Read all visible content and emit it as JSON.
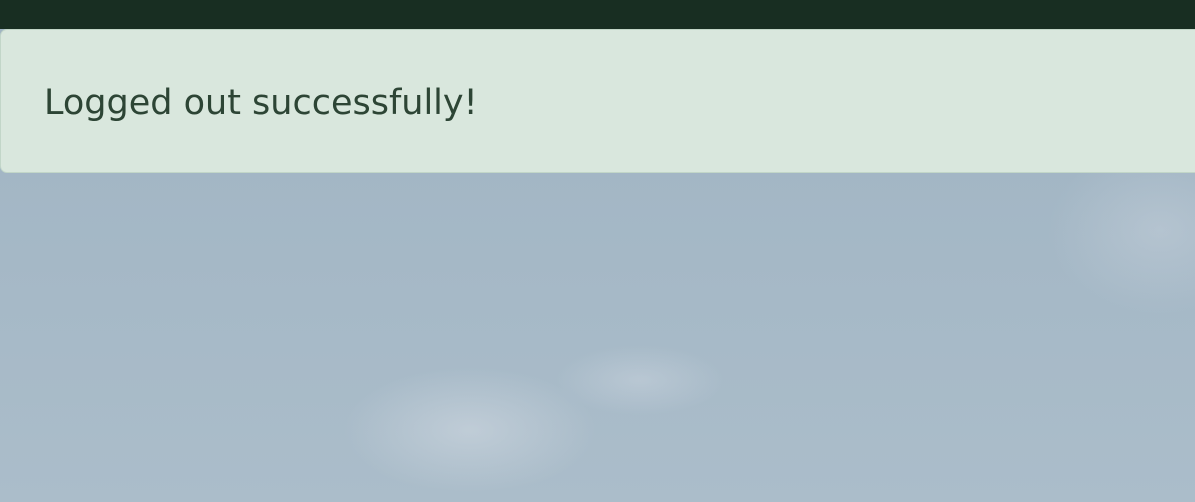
{
  "alert": {
    "message": "Logged out successfully!",
    "type": "success"
  },
  "colors": {
    "top_bar": "#182e22",
    "alert_background": "#d9e7dd",
    "alert_text": "#2d4535",
    "page_background": "#a5b8c6"
  }
}
